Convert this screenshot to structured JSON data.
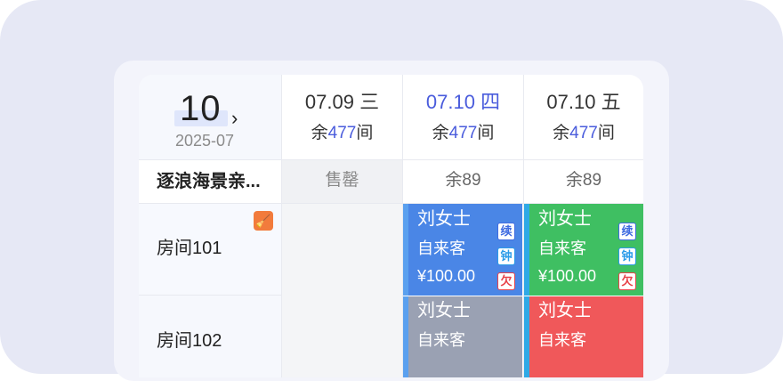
{
  "calendar": {
    "day": "10",
    "year_month": "2025-07",
    "next_icon": "chevron-right-icon"
  },
  "columns": [
    {
      "date": "07.09 三",
      "remain_prefix": "余",
      "remain_count": "477",
      "remain_suffix": "间",
      "active": false
    },
    {
      "date": "07.10 四",
      "remain_prefix": "余",
      "remain_count": "477",
      "remain_suffix": "间",
      "active": true
    },
    {
      "date": "07.10 五",
      "remain_prefix": "余",
      "remain_count": "477",
      "remain_suffix": "间",
      "active": false
    }
  ],
  "room_type": {
    "name": "逐浪海景亲...",
    "cells": [
      "售罄",
      "余89",
      "余89"
    ]
  },
  "rooms": [
    {
      "label": "房间101",
      "status_icon": "broom-icon"
    },
    {
      "label": "房间102"
    }
  ],
  "bookings": [
    {
      "name": "刘女士",
      "source": "自来客",
      "amount": "¥100.00",
      "color": "#4a86e6",
      "stripe": "#5aa0ef",
      "tags": [
        {
          "text": "续",
          "color": "#3f6be0"
        },
        {
          "text": "钟",
          "color": "#2a9be8"
        },
        {
          "text": "欠",
          "color": "#e8434a"
        }
      ]
    },
    {
      "name": "刘女士",
      "source": "自来客",
      "amount": "¥100.00",
      "color": "#3fbf62",
      "stripe": "#2fa9e6",
      "tags": [
        {
          "text": "续",
          "color": "#3f6be0"
        },
        {
          "text": "钟",
          "color": "#2a9be8"
        },
        {
          "text": "欠",
          "color": "#e8434a"
        }
      ]
    },
    {
      "name": "刘女士",
      "source": "自来客",
      "color": "#9aa1b3",
      "stripe": "#5aa0ef"
    },
    {
      "name": "刘女士",
      "source": "自来客",
      "color": "#f0585a",
      "stripe": "#2fa9e6"
    }
  ],
  "colors": {
    "accent": "#4a5cdc",
    "page_bg": "#e6e8f5"
  }
}
